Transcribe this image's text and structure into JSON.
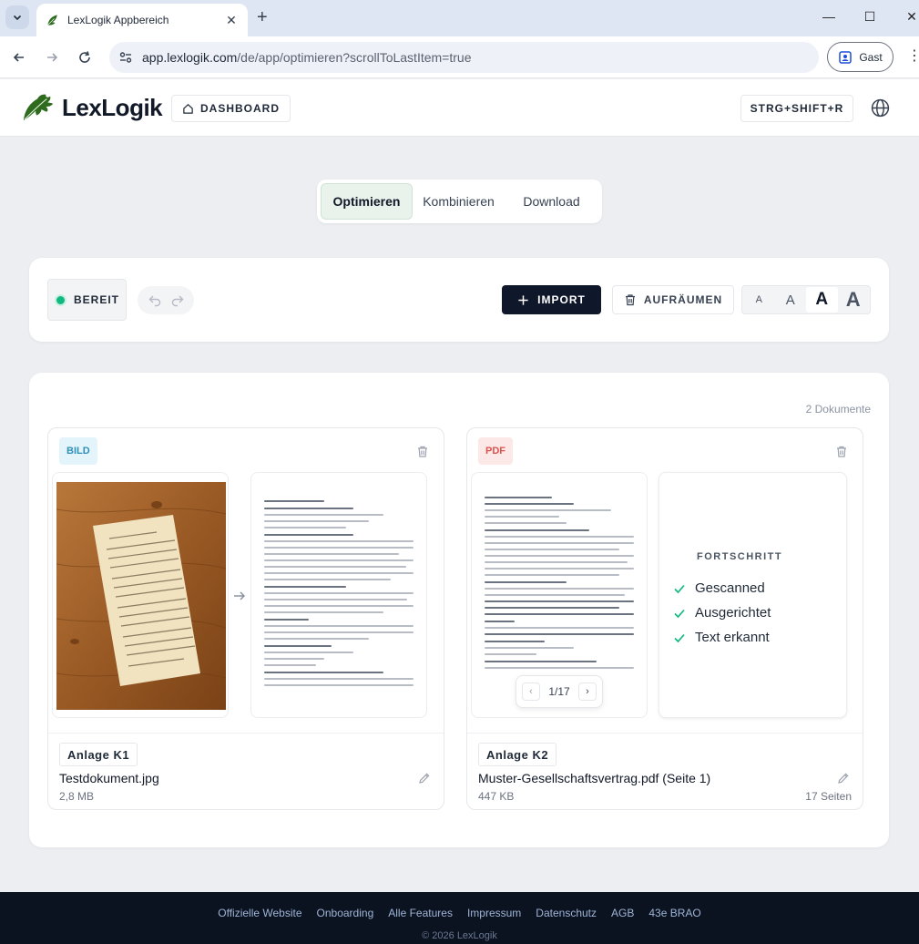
{
  "browser": {
    "tab_title": "LexLogik Appbereich",
    "url_host": "app.lexlogik.com",
    "url_path": "/de/app/optimieren?scrollToLastItem=true",
    "profile_label": "Gast"
  },
  "header": {
    "brand": "LexLogik",
    "dashboard_label": "DASHBOARD",
    "shortcut_label": "STRG+SHIFT+R"
  },
  "modes": [
    {
      "label": "Optimieren",
      "active": true
    },
    {
      "label": "Kombinieren",
      "active": false
    },
    {
      "label": "Download",
      "active": false
    }
  ],
  "toolbar": {
    "status_label": "BEREIT",
    "import_label": "IMPORT",
    "cleanup_label": "AUFRÄUMEN",
    "font_sizes": [
      "A",
      "A",
      "A",
      "A"
    ],
    "font_size_selected_index": 2
  },
  "documents": {
    "count_label": "2 Dokumente",
    "items": [
      {
        "badge": "BILD",
        "tag": "Anlage K1",
        "filename": "Testdokument.jpg",
        "size": "2,8 MB"
      },
      {
        "badge": "PDF",
        "tag": "Anlage K2",
        "filename": "Muster-Gesellschaftsvertrag.pdf (Seite 1)",
        "size": "447 KB",
        "pages": "17 Seiten",
        "pager": "1/17",
        "progress_title": "FORTSCHRITT",
        "progress_steps": [
          "Gescanned",
          "Ausgerichtet",
          "Text erkannt"
        ]
      }
    ]
  },
  "footer": {
    "links": [
      "Offizielle Website",
      "Onboarding",
      "Alle Features",
      "Impressum",
      "Datenschutz",
      "AGB",
      "43e BRAO"
    ],
    "copyright": "© 2026 LexLogik"
  },
  "colors": {
    "accent_dark": "#0f172a",
    "status_green": "#10b981",
    "brand_green": "#2e6b1f",
    "badge_image": "#2f90b8",
    "badge_pdf": "#d9534f"
  }
}
